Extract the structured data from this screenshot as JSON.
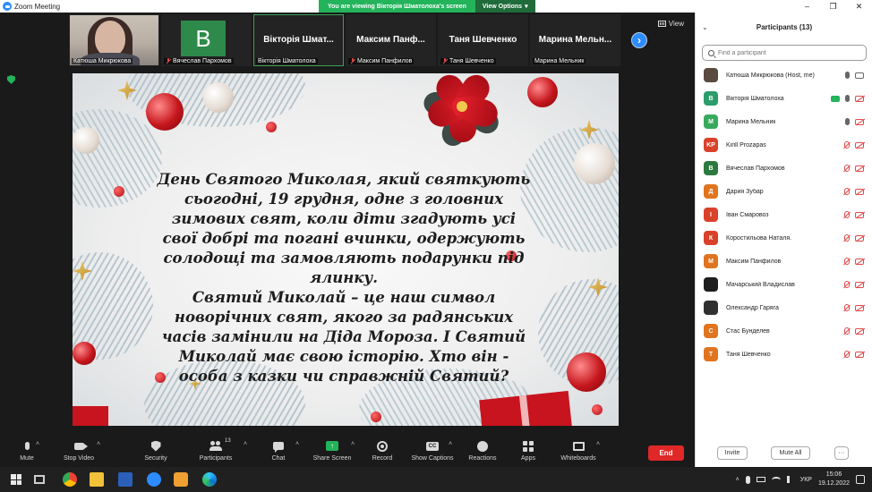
{
  "window": {
    "title": "Zoom Meeting",
    "viewing_banner": "You are viewing Вікторія Шматолоха's screen",
    "view_options": "View Options",
    "minimize": "–",
    "maximize": "❐",
    "close": "✕"
  },
  "meeting": {
    "view_label": "View",
    "thumbnails": [
      {
        "big_name": "",
        "label": "Катюша Микрюкова",
        "muted": false
      },
      {
        "big_name": "",
        "avatar_letter": "В",
        "label": "Вячеслав Пархомов",
        "muted": true
      },
      {
        "big_name": "Вікторія Шмат...",
        "label": "Вікторія Шматолоха",
        "muted": false
      },
      {
        "big_name": "Максим Панф...",
        "label": "Максим Панфилов",
        "muted": true
      },
      {
        "big_name": "Таня Шевченко",
        "label": "Таня Шевченко",
        "muted": true
      },
      {
        "big_name": "Марина Мельн...",
        "label": "Марина Мельник",
        "muted": false
      }
    ],
    "next_page": "›"
  },
  "slide": {
    "lines": [
      "День Святого Миколая, який святкують",
      "сьогодні, 19 грудня, одне з головних",
      "зимових свят, коли діти згадують усі",
      "свої добрі та погані вчинки, одержують",
      "солодощі та замовляють подарунки під",
      "ялинку.",
      "Святий Миколай – це наш символ",
      "новорічних свят, якого за радянських",
      "часів замінили на Діда Мороза. І Святий",
      "Миколай має свою історію. Хто він -",
      "особа з казки чи справжній Святий?"
    ]
  },
  "toolbar": {
    "mute": "Mute",
    "stop_video": "Stop Video",
    "security": "Security",
    "participants": "Participants",
    "participants_count": "13",
    "chat": "Chat",
    "share_screen": "Share Screen",
    "record": "Record",
    "captions": "Show Captions",
    "captions_glyph": "CC",
    "reactions": "Reactions",
    "apps": "Apps",
    "whiteboards": "Whiteboards",
    "end": "End"
  },
  "panel": {
    "title": "Participants (13)",
    "collapse": "⌄",
    "search_placeholder": "Find a participant",
    "invite": "Invite",
    "mute_all": "Mute All",
    "more": "···",
    "participants": [
      {
        "name": "Катюша Микрюкова (Host, me)",
        "initials": "",
        "color": "#5a4a40",
        "mic": "on",
        "cam": "on",
        "sharing": false
      },
      {
        "name": "Вікторія Шматолоха",
        "initials": "В",
        "color": "#2a9d6a",
        "mic": "on",
        "cam": "off",
        "sharing": true
      },
      {
        "name": "Марина Мельник",
        "initials": "М",
        "color": "#39a95e",
        "mic": "on",
        "cam": "off",
        "sharing": false
      },
      {
        "name": "Kirill Prozapas",
        "initials": "KP",
        "color": "#d9412b",
        "mic": "off",
        "cam": "off",
        "sharing": false
      },
      {
        "name": "Вячеслав Пархомов",
        "initials": "В",
        "color": "#2d7a3e",
        "mic": "off",
        "cam": "off",
        "sharing": false
      },
      {
        "name": "Дария Зубар",
        "initials": "Д",
        "color": "#e0741f",
        "mic": "off",
        "cam": "off",
        "sharing": false
      },
      {
        "name": "Іван Смаровоз",
        "initials": "І",
        "color": "#d9412b",
        "mic": "off",
        "cam": "off",
        "sharing": false
      },
      {
        "name": "Коростильова Наталя.",
        "initials": "К",
        "color": "#d9412b",
        "mic": "off",
        "cam": "off",
        "sharing": false
      },
      {
        "name": "Максим  Панфилов",
        "initials": "М",
        "color": "#e0741f",
        "mic": "off",
        "cam": "off",
        "sharing": false
      },
      {
        "name": "Мачарський Владислав",
        "initials": "",
        "color": "#1e1e1e",
        "mic": "off",
        "cam": "off",
        "sharing": false
      },
      {
        "name": "Олександр Гаряга",
        "initials": "",
        "color": "#303030",
        "mic": "off",
        "cam": "off",
        "sharing": false
      },
      {
        "name": "Стас Бунделев",
        "initials": "С",
        "color": "#e0741f",
        "mic": "off",
        "cam": "off",
        "sharing": false
      },
      {
        "name": "Таня Шевченко",
        "initials": "Т",
        "color": "#e0741f",
        "mic": "off",
        "cam": "off",
        "sharing": false
      }
    ]
  },
  "taskbar": {
    "language": "УКР",
    "time": "15:06",
    "date": "19.12.2022",
    "up_arrow": "˄"
  }
}
